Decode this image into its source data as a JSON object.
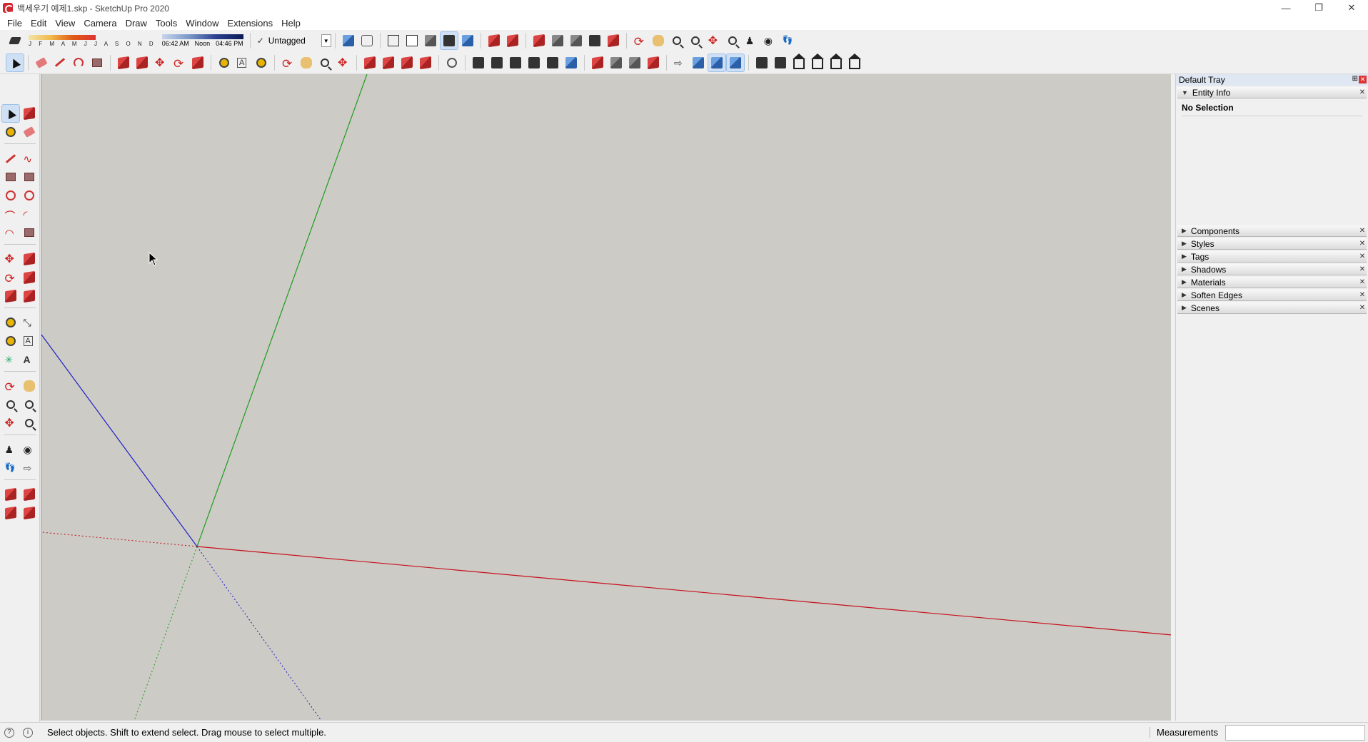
{
  "window": {
    "title": "백세우기 예제1.skp - SketchUp Pro 2020",
    "minimize": "—",
    "restore": "❐",
    "close": "✕"
  },
  "menu": [
    "File",
    "Edit",
    "View",
    "Camera",
    "Draw",
    "Tools",
    "Window",
    "Extensions",
    "Help"
  ],
  "shadow_settings": {
    "months": "J F M A M J J A S O N D",
    "time_start": "06:42 AM",
    "time_mid": "Noon",
    "time_end": "04:46 PM"
  },
  "tags": {
    "current": "Untagged",
    "check": "✓",
    "dropdown": "▼"
  },
  "tray": {
    "title": "Default Tray",
    "pin": "⊞",
    "close": "✕",
    "entity_info": {
      "label": "Entity Info",
      "selection": "No Selection"
    },
    "panels": [
      "Components",
      "Styles",
      "Tags",
      "Shadows",
      "Materials",
      "Soften Edges",
      "Scenes"
    ]
  },
  "status": {
    "hint": "Select objects. Shift to extend select. Drag mouse to select multiple.",
    "measurements_label": "Measurements",
    "measurements_value": ""
  },
  "colors": {
    "viewport_bg": "#cccbc5",
    "axis_red": "#c8101d",
    "axis_green": "#1f9d1f",
    "axis_blue": "#1e1ec8"
  }
}
